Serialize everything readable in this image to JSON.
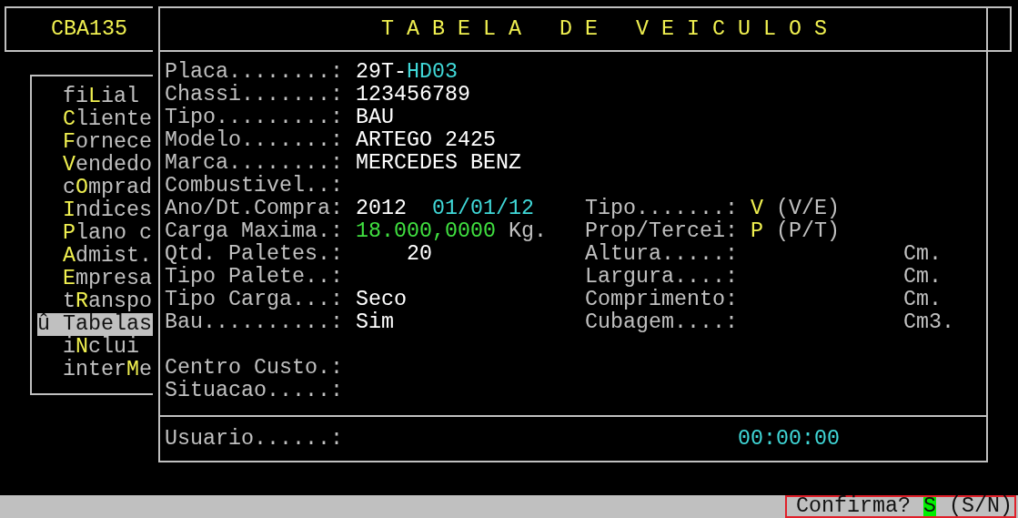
{
  "header": {
    "program": "CBA135"
  },
  "menu": {
    "items": [
      {
        "pre": "fi",
        "key": "L",
        "post": "ial",
        "selected": false
      },
      {
        "key": "C",
        "post": "liente",
        "selected": false
      },
      {
        "key": "F",
        "post": "ornece",
        "selected": false
      },
      {
        "key": "V",
        "post": "endedo",
        "selected": false
      },
      {
        "pre": "c",
        "key": "O",
        "post": "mprad",
        "selected": false
      },
      {
        "key": "I",
        "post": "ndices",
        "selected": false
      },
      {
        "key": "P",
        "post": "lano c",
        "selected": false
      },
      {
        "key": "A",
        "post": "dmist.",
        "selected": false
      },
      {
        "key": "E",
        "post": "mpresa",
        "selected": false
      },
      {
        "pre": "t",
        "key": "R",
        "post": "anspo",
        "selected": false
      },
      {
        "marker": "û",
        "pre": "Tabelas",
        "selected": true
      },
      {
        "pre": "i",
        "key": "N",
        "post": "clui",
        "selected": false
      },
      {
        "pre": "inter",
        "key": "M",
        "post": "e",
        "selected": false
      }
    ]
  },
  "window": {
    "title": "T A B E L A   D E   V E I C U L O S",
    "fields": [
      {
        "kind": "text",
        "label": "Placa........:",
        "value": [
          {
            "text": "29T-",
            "color": "#ffffff"
          },
          {
            "text": "HD03",
            "color": "#40d8d8"
          }
        ]
      },
      {
        "kind": "text",
        "label": "Chassi.......:",
        "value": [
          {
            "text": "123456789",
            "color": "#ffffff"
          }
        ]
      },
      {
        "kind": "text",
        "label": "Tipo.........:",
        "value": [
          {
            "text": "BAU",
            "color": "#ffffff"
          }
        ]
      },
      {
        "kind": "text",
        "label": "Modelo.......:",
        "value": [
          {
            "text": "ARTEGO 2425",
            "color": "#ffffff"
          }
        ]
      },
      {
        "kind": "text",
        "label": "Marca........:",
        "value": [
          {
            "text": "MERCEDES BENZ",
            "color": "#ffffff"
          }
        ]
      },
      {
        "kind": "text",
        "label": "Combustivel..:"
      },
      {
        "kind": "text",
        "label": "Ano/Dt.Compra:",
        "value": [
          {
            "text": "2012",
            "color": "#ffffff"
          }
        ],
        "date": "01/01/12"
      },
      {
        "kind": "text",
        "label": "Carga Maxima.:",
        "value": [
          {
            "text": "18.000,0000",
            "color": "#40e040"
          }
        ],
        "unit": "Kg."
      },
      {
        "kind": "numeric",
        "label": "Qtd. Paletes.:",
        "value": [
          {
            "text": "20",
            "color": "#ffffff"
          }
        ]
      },
      {
        "kind": "text",
        "label": "Tipo Palete..:"
      },
      {
        "kind": "text",
        "label": "Tipo Carga...:",
        "value": [
          {
            "text": "Seco",
            "color": "#ffffff"
          }
        ]
      },
      {
        "kind": "text",
        "label": "Bau..........:",
        "value": [
          {
            "text": "Sim",
            "color": "#ffffff"
          }
        ]
      }
    ],
    "right_fields": [
      {
        "label": "Tipo.......:",
        "value": "V",
        "hint": "(V/E)"
      },
      {
        "label": "Prop/Tercei:",
        "value": "P",
        "hint": "(P/T)"
      },
      {
        "label": "Altura.....:",
        "unit": "Cm."
      },
      {
        "label": "Largura....:",
        "unit": "Cm."
      },
      {
        "label": "Comprimento:",
        "unit": "Cm."
      },
      {
        "label": "Cubagem....:",
        "unit": "Cm3."
      }
    ],
    "extra_fields": [
      {
        "label": "Centro Custo.:"
      },
      {
        "label": "Situacao.....:"
      }
    ],
    "footer": {
      "label": "Usuario......:",
      "time": "00:00:00"
    }
  },
  "status_bar": {
    "prompt": "Confirma?",
    "answer": "S",
    "options": "(S/N)"
  }
}
